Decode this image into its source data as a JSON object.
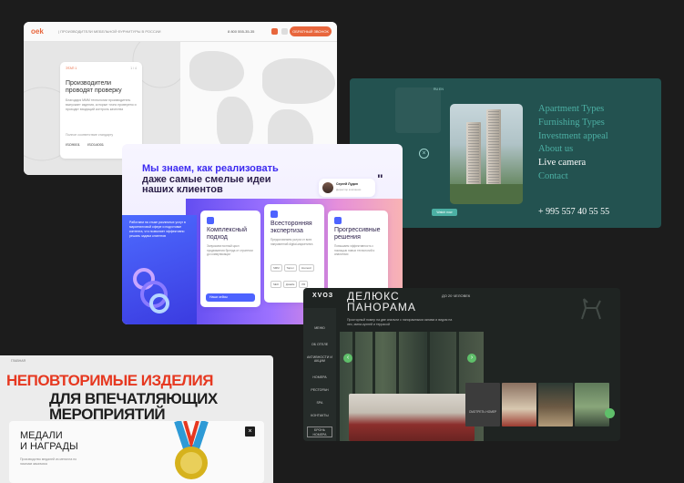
{
  "card_oek": {
    "logo": "oek",
    "tagline": "| ПРОИЗВОДИТЕЛИ МЕБЕЛЬНОЙ ФУРНИТУРЫ В РОССИИ",
    "phone": "8 800 555-35-35",
    "cta": "ОБРАТНЫЙ ЗВОНОК",
    "step_label": "ЭТАП 1",
    "step_count": "1 / 4",
    "title": "Производители проводят проверку",
    "description": "Благодаря МММ технологии производитель выпускает изделия, которые точно проверено и проходят входящий контроль качества",
    "sub": "Полное соответствие стандарту",
    "number1": "ISO9001",
    "number2": "ISO14001",
    "accent": "#e8663c"
  },
  "card_teal": {
    "nav": "RU  EN",
    "menu": [
      "Apartment Types",
      "Furnishing Types",
      "Investment appeal",
      "About us",
      "Live camera",
      "Contact"
    ],
    "active_index": 4,
    "phone": "+ 995 557 40 55 55",
    "tag": "Watch now",
    "close_icon": "close-icon",
    "bg": "#235250",
    "accent": "#4cb0a4"
  },
  "card_purple": {
    "headline_1": "Мы знаем, как реализовать",
    "headline_2": "даже самые смелые идеи",
    "headline_3": "наших клиентов",
    "quote_name": "Сергей Лудин",
    "quote_role": "Директор компании",
    "blue_text": "Работаем на стыке различных услуг в маркетинговой сфере и подготовке контента, что позволяет эффективно решать задачи клиентов",
    "columns": [
      {
        "title": "Комплексный подход",
        "desc": "Запускаем полный цикл продвижения бренда от стратегии до коммуникации",
        "chips": []
      },
      {
        "title": "Всесторонняя экспертиза",
        "desc": "Предоставляем услуги от всех направлений digital-маркетинга",
        "chips": [
          "SMM",
          "Таргет",
          "Контекст",
          "SEO",
          "Дизайн",
          "PR"
        ]
      },
      {
        "title": "Прогрессивные решения",
        "desc": "Повышаем эффективность с помощью новых технологий и аналитики",
        "chips": []
      }
    ],
    "cta": "Наши кейсы",
    "accent": "#3c2af0"
  },
  "card_hotel": {
    "logo": "ХVOЗ",
    "people": "ДО 20 ЧЕЛОВЕК",
    "title_1": "ДЕЛЮКС",
    "title_2": "ПАНОРАМА",
    "description": "Просторный номер на две спальни с панорамными окнами и видом на лес, мини-кухней и террасой",
    "side_menu": [
      "МЕНЮ",
      "ОБ ОТЕЛЕ",
      "АКТИВНОСТИ И АКЦИИ",
      "НОМЕРА",
      "РЕСТОРАН",
      "SPA",
      "КОНТАКТЫ"
    ],
    "booking": "БРОНЬ НОМЕРА",
    "thumb_label": "СМОТРЕТЬ НОМЕР",
    "arrow_left": "‹",
    "arrow_right": "›",
    "accent": "#5fbf6a"
  },
  "card_medals": {
    "top_label": "ГЛАВНАЯ",
    "headline_1": "НЕПОВТОРИМЫЕ ИЗДЕЛИЯ",
    "headline_2": "ДЛЯ ВПЕЧАТЛЯЮЩИХ МЕРОПРИЯТИЙ",
    "label_1": "МЕДАЛИ",
    "label_2": "И НАГРАДЫ",
    "sub": "Производство медалей из металла по эскизам заказчика",
    "close": "×",
    "accent": "#e63820"
  }
}
